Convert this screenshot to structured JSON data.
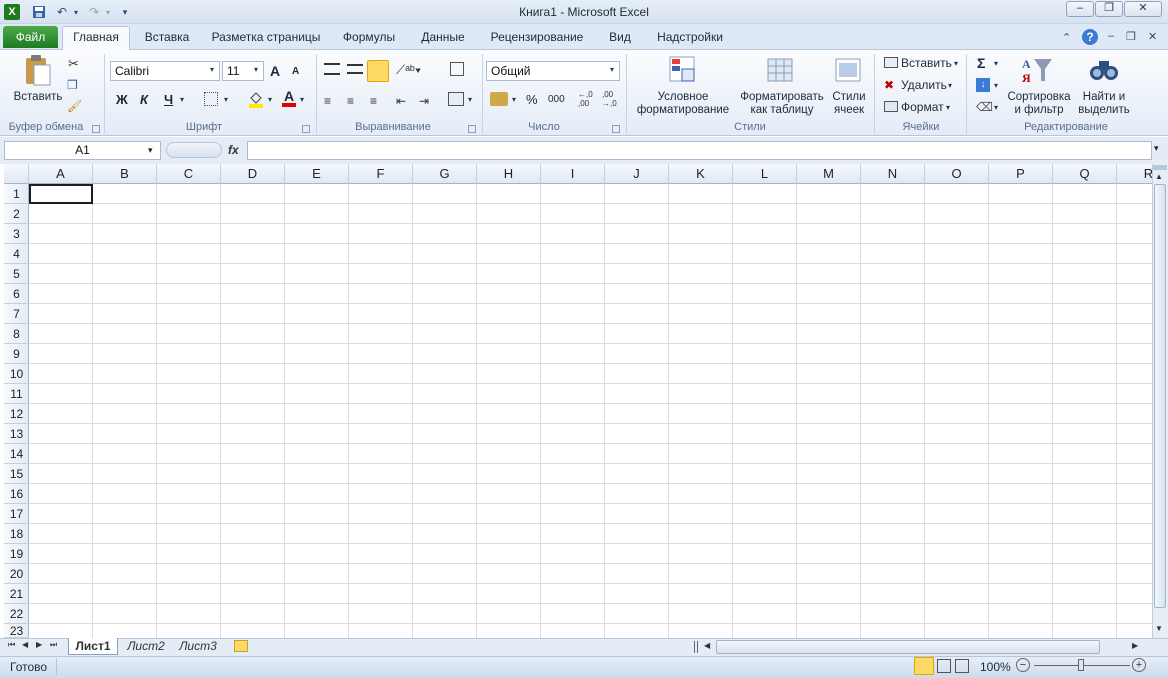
{
  "window": {
    "title": "Книга1  -  Microsoft Excel",
    "min": "–",
    "max": "❐",
    "close": "✕"
  },
  "tabs": {
    "file": "Файл",
    "items": [
      "Главная",
      "Вставка",
      "Разметка страницы",
      "Формулы",
      "Данные",
      "Рецензирование",
      "Вид",
      "Надстройки"
    ]
  },
  "clipboard": {
    "paste": "Вставить",
    "label": "Буфер обмена"
  },
  "font": {
    "name": "Calibri",
    "size": "11",
    "bold": "Ж",
    "italic": "К",
    "underline": "Ч",
    "grow": "A",
    "shrink": "A",
    "color_letter": "A",
    "label": "Шрифт"
  },
  "alignment": {
    "label": "Выравнивание"
  },
  "number": {
    "format": "Общий",
    "percent": "%",
    "thousands": "000",
    "label": "Число"
  },
  "styles": {
    "conditional": [
      "Условное",
      "форматирование"
    ],
    "as_table": [
      "Форматировать",
      "как таблицу"
    ],
    "cell_styles": [
      "Стили",
      "ячеек"
    ],
    "label": "Стили"
  },
  "cells": {
    "insert": "Вставить",
    "delete": "Удалить",
    "format": "Формат",
    "label": "Ячейки"
  },
  "editing": {
    "sigma": "Σ",
    "sort": [
      "Сортировка",
      "и фильтр"
    ],
    "find": [
      "Найти и",
      "выделить"
    ],
    "label": "Редактирование"
  },
  "formula_bar": {
    "name_box": "A1",
    "fx": "fx",
    "value": ""
  },
  "columns": [
    "A",
    "B",
    "C",
    "D",
    "E",
    "F",
    "G",
    "H",
    "I",
    "J",
    "K",
    "L",
    "M",
    "N",
    "O",
    "P",
    "Q",
    "R"
  ],
  "rows": [
    "1",
    "2",
    "3",
    "4",
    "5",
    "6",
    "7",
    "8",
    "9",
    "10",
    "11",
    "12",
    "13",
    "14",
    "15",
    "16",
    "17",
    "18",
    "19",
    "20",
    "21",
    "22",
    "23"
  ],
  "sheets": {
    "items": [
      "Лист1",
      "Лист2",
      "Лист3"
    ],
    "active": "Лист1"
  },
  "status": {
    "ready": "Готово",
    "zoom": "100%",
    "minus": "−",
    "plus": "+"
  }
}
